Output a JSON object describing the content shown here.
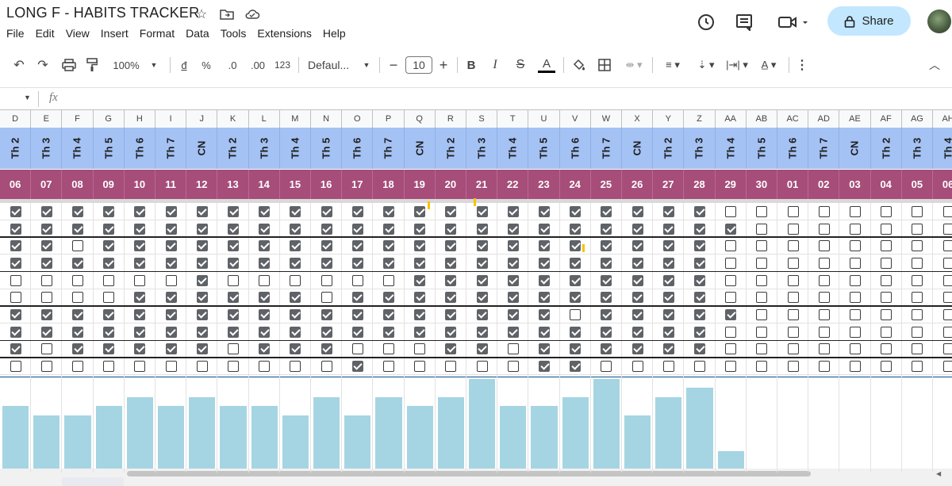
{
  "document": {
    "title": "LONG F - HABITS TRACKER"
  },
  "menu": [
    "File",
    "Edit",
    "View",
    "Insert",
    "Format",
    "Data",
    "Tools",
    "Extensions",
    "Help"
  ],
  "share_label": "Share",
  "toolbar": {
    "zoom": "100%",
    "currency": "đ",
    "percent": "%",
    "decrease_decimal": ".0",
    "increase_decimal": ".00",
    "format_123": "123",
    "font": "Defaul...",
    "font_size": "10",
    "bold": "B",
    "italic": "I",
    "text_color": "A",
    "more": "⋮"
  },
  "formula_bar": {
    "fx": "fx"
  },
  "columns": [
    "D",
    "E",
    "F",
    "G",
    "H",
    "I",
    "J",
    "K",
    "L",
    "M",
    "N",
    "O",
    "P",
    "Q",
    "R",
    "S",
    "T",
    "U",
    "V",
    "W",
    "X",
    "Y",
    "Z",
    "AA",
    "AB",
    "AC",
    "AD",
    "AE",
    "AF",
    "AG",
    "AH"
  ],
  "days": [
    "Th 2",
    "Th 3",
    "Th 4",
    "Th 5",
    "Th 6",
    "Th 7",
    "CN",
    "Th 2",
    "Th 3",
    "Th 4",
    "Th 5",
    "Th 6",
    "Th 7",
    "CN",
    "Th 2",
    "Th 3",
    "Th 4",
    "Th 5",
    "Th 6",
    "Th 7",
    "CN",
    "Th 2",
    "Th 3",
    "Th 4",
    "Th 5",
    "Th 6",
    "Th 7",
    "CN",
    "Th 2",
    "Th 3",
    "Th 4"
  ],
  "dates": [
    "06",
    "07",
    "08",
    "09",
    "10",
    "11",
    "12",
    "13",
    "14",
    "15",
    "16",
    "17",
    "18",
    "19",
    "20",
    "21",
    "22",
    "23",
    "24",
    "25",
    "26",
    "27",
    "28",
    "29",
    "30",
    "01",
    "02",
    "03",
    "04",
    "05",
    "06"
  ],
  "habit_checks": [
    "1111111111111111111111100000000",
    "1111111111111111111111110000000",
    "1101111111111111111111100000000",
    "1111111111111111111111100000000",
    "0000001000000111111111100000000",
    "0000111111011111111111100000000",
    "1111111111111111110111110000000",
    "1111111111111111111111100000000",
    "1011111011100011011111100000000",
    "0000000000010000011000000000000"
  ],
  "chart_data": {
    "type": "bar",
    "categories": [
      "06",
      "07",
      "08",
      "09",
      "10",
      "11",
      "12",
      "13",
      "14",
      "15",
      "16",
      "17",
      "18",
      "19",
      "20",
      "21",
      "22",
      "23",
      "24",
      "25",
      "26",
      "27",
      "28",
      "29",
      "30",
      "01",
      "02",
      "03",
      "04",
      "05",
      "06"
    ],
    "values": [
      7,
      6,
      6,
      7,
      8,
      7,
      8,
      7,
      7,
      6,
      8,
      6,
      8,
      7,
      8,
      10,
      7,
      7,
      8,
      10,
      6,
      8,
      9,
      2,
      0,
      0,
      0,
      0,
      0,
      0,
      0
    ],
    "ylim": [
      0,
      10
    ],
    "color": "#a5d5e2"
  },
  "colors": {
    "day_row": "#a4c2f4",
    "date_row": "#a64d79",
    "share_bg": "#c2e7ff",
    "checkbox_checked": "#5f6368"
  }
}
